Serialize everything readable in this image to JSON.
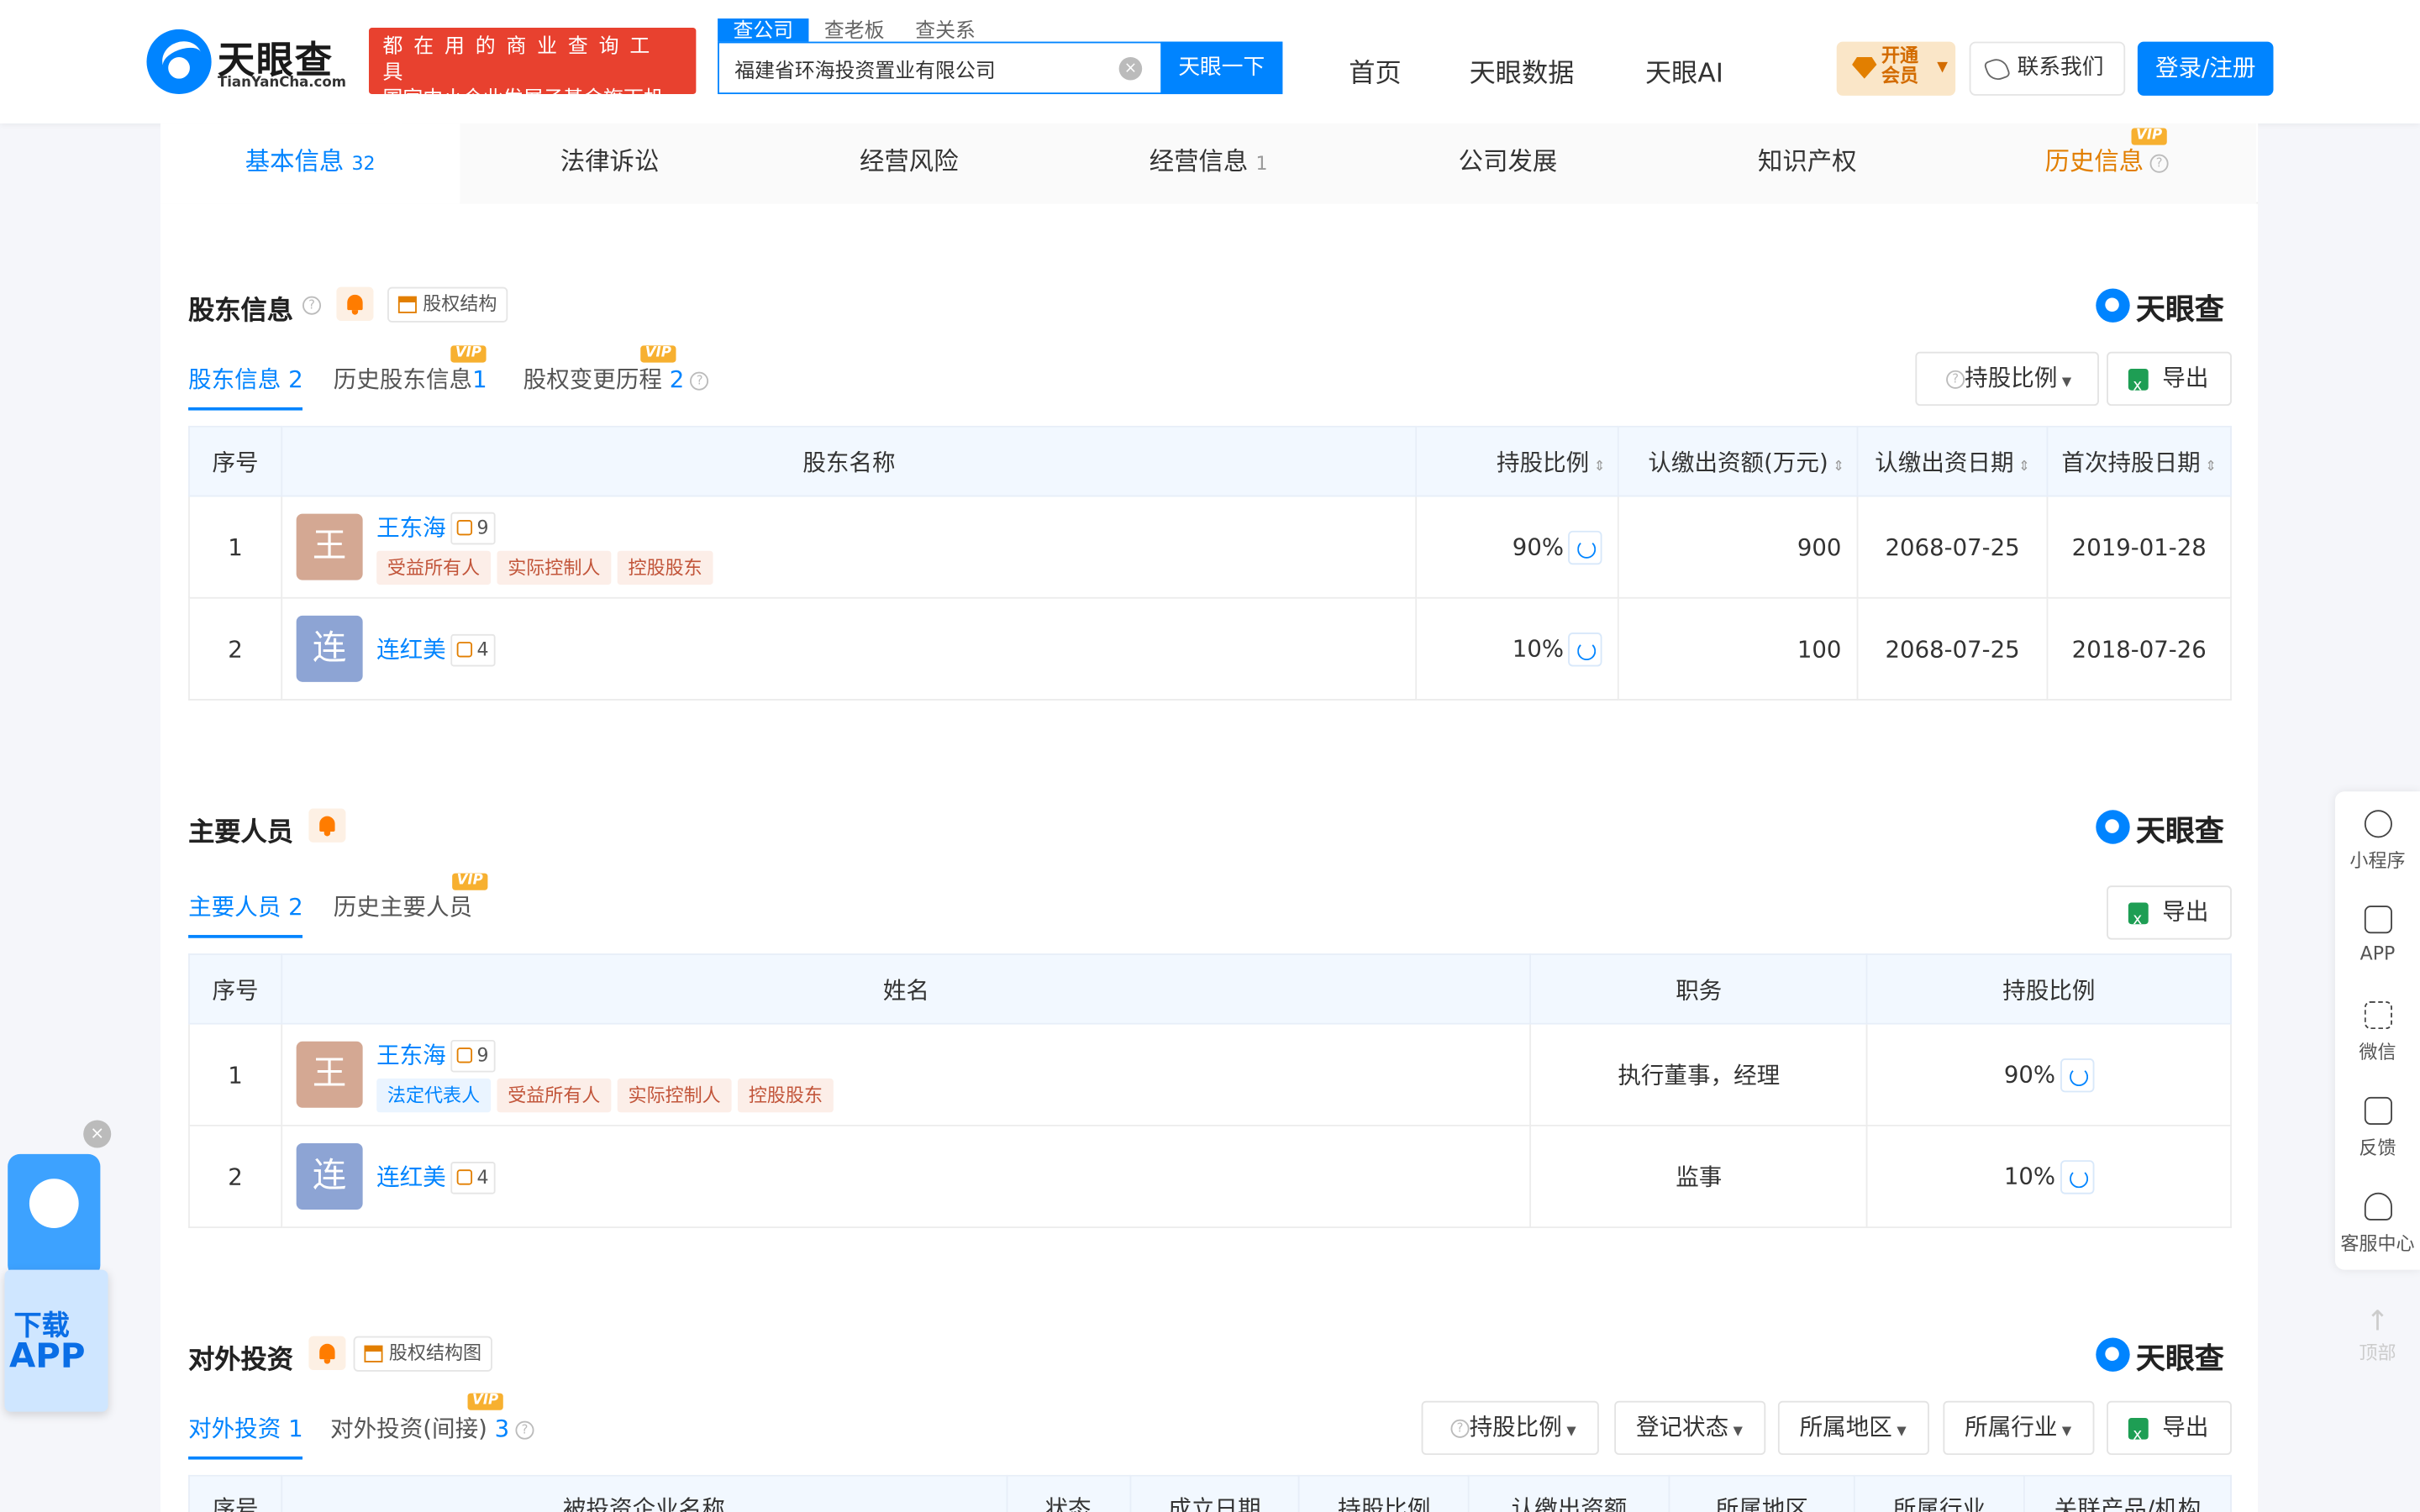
{
  "header": {
    "logo_name": "天眼查",
    "logo_sub": "TianYanCha.com",
    "slogan_line1": "都在用的商业查询工具",
    "slogan_line2": "国家中小企业发展子基金旗下机构",
    "search_tabs": [
      "查公司",
      "查老板",
      "查关系"
    ],
    "search_value": "福建省环海投资置业有限公司",
    "search_button": "天眼一下",
    "nav": [
      "首页",
      "天眼数据",
      "天眼AI"
    ],
    "vip_l1": "开通",
    "vip_l2": "会员",
    "contact": "联系我们",
    "login": "登录/注册"
  },
  "tabs": [
    {
      "label": "基本信息",
      "count": "32"
    },
    {
      "label": "法律诉讼",
      "count": ""
    },
    {
      "label": "经营风险",
      "count": ""
    },
    {
      "label": "经营信息",
      "count": "1"
    },
    {
      "label": "公司发展",
      "count": ""
    },
    {
      "label": "知识产权",
      "count": ""
    },
    {
      "label": "历史信息",
      "count": ""
    }
  ],
  "vip_tag": "VIP",
  "brand": "天眼查",
  "shareholders": {
    "title": "股东信息",
    "struct_btn": "股权结构",
    "subtabs": [
      {
        "label": "股东信息",
        "count": "2"
      },
      {
        "label": "历史股东信息",
        "count": "1"
      },
      {
        "label": "股权变更历程",
        "count": "2"
      }
    ],
    "filter_btn": "持股比例",
    "export_btn": "导出",
    "headers": [
      "序号",
      "股东名称",
      "持股比例",
      "认缴出资额(万元)",
      "认缴出资日期",
      "首次持股日期"
    ],
    "rows": [
      {
        "no": "1",
        "avatar": "王",
        "name": "王东海",
        "rel": "9",
        "tags": [
          "受益所有人",
          "实际控制人",
          "控股股东"
        ],
        "ratio": "90%",
        "amount": "900",
        "date": "2068-07-25",
        "first": "2019-01-28"
      },
      {
        "no": "2",
        "avatar": "连",
        "name": "连红美",
        "rel": "4",
        "tags": [],
        "ratio": "10%",
        "amount": "100",
        "date": "2068-07-25",
        "first": "2018-07-26"
      }
    ]
  },
  "staff": {
    "title": "主要人员",
    "subtabs": [
      {
        "label": "主要人员",
        "count": "2"
      },
      {
        "label": "历史主要人员",
        "count": ""
      }
    ],
    "export_btn": "导出",
    "headers": [
      "序号",
      "姓名",
      "职务",
      "持股比例"
    ],
    "rows": [
      {
        "no": "1",
        "avatar": "王",
        "name": "王东海",
        "rel": "9",
        "tag_legal": "法定代表人",
        "tags": [
          "受益所有人",
          "实际控制人",
          "控股股东"
        ],
        "position": "执行董事，经理",
        "ratio": "90%"
      },
      {
        "no": "2",
        "avatar": "连",
        "name": "连红美",
        "rel": "4",
        "position": "监事",
        "ratio": "10%"
      }
    ]
  },
  "invest": {
    "title": "对外投资",
    "struct_btn": "股权结构图",
    "subtabs": [
      {
        "label": "对外投资",
        "count": "1"
      },
      {
        "label": "对外投资(间接)",
        "count": "3"
      }
    ],
    "filters": [
      "持股比例",
      "登记状态",
      "所属地区",
      "所属行业"
    ],
    "export_btn": "导出",
    "headers": [
      "序号",
      "被投资企业名称",
      "状态",
      "成立日期",
      "持股比例",
      "认缴出资额",
      "所属地区",
      "所属行业",
      "关联产品/机构"
    ]
  },
  "side": {
    "items": [
      "小程序",
      "APP",
      "微信",
      "反馈",
      "客服中心"
    ],
    "top": "顶部"
  },
  "download": {
    "close": "×",
    "line1": "下载",
    "line2": "APP"
  },
  "colors": {
    "accent": "#0084ff",
    "vip": "#e27f00",
    "tag": "#c2553a"
  }
}
